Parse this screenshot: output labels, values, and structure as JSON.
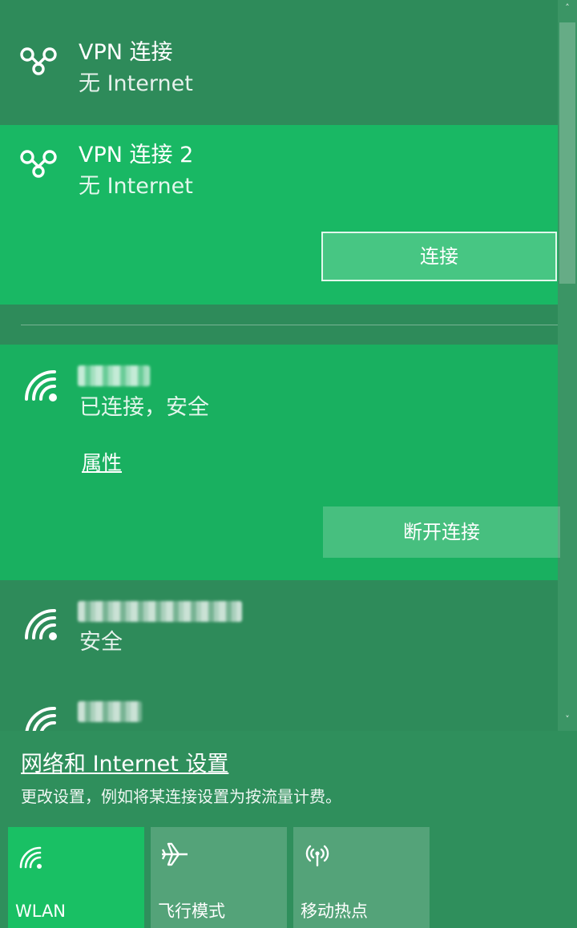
{
  "vpn_connections": [
    {
      "name": "VPN 连接",
      "status": "无 Internet",
      "icon": "vpn-icon"
    },
    {
      "name": "VPN 连接 2",
      "status": "无 Internet",
      "icon": "vpn-icon",
      "connect_label": "连接"
    }
  ],
  "wifi_connected": {
    "icon": "wifi-icon",
    "status": "已连接，安全",
    "properties_label": "属性",
    "disconnect_label": "断开连接"
  },
  "wifi_networks": [
    {
      "icon": "wifi-icon",
      "status": "安全"
    },
    {
      "icon": "wifi-icon"
    }
  ],
  "settings": {
    "link_label": "网络和 Internet 设置",
    "description": "更改设置，例如将某连接设置为按流量计费。"
  },
  "quick_actions": [
    {
      "label": "WLAN",
      "icon": "wifi-icon",
      "active": true
    },
    {
      "label": "飞行模式",
      "icon": "airplane-icon",
      "active": false
    },
    {
      "label": "移动热点",
      "icon": "hotspot-icon",
      "active": false
    }
  ],
  "colors": {
    "panel_bg": "#2f8f5c",
    "selected_bg": "#19b864",
    "active_tile": "#19c064"
  },
  "scrollbar": {
    "up_arrow": "˄",
    "down_arrow": "˅"
  }
}
